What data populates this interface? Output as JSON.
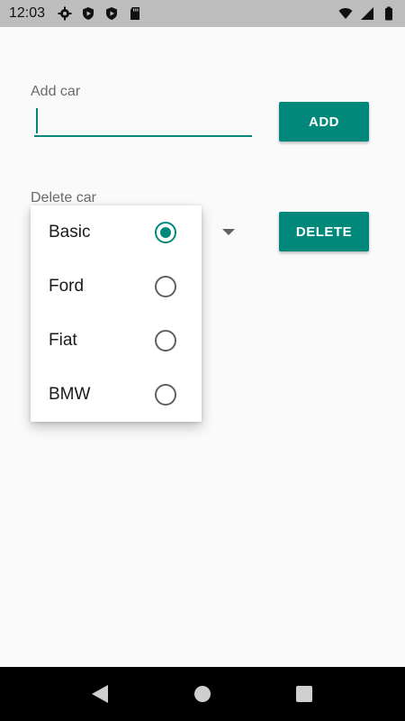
{
  "status_bar": {
    "time": "12:03",
    "left_icons": [
      "gear-icon",
      "play-shield-icon",
      "play-shield-icon",
      "sd-card-icon"
    ],
    "right_icons": [
      "wifi-icon",
      "signal-icon",
      "battery-icon"
    ]
  },
  "add_section": {
    "label": "Add car",
    "input_value": "",
    "button_label": "ADD"
  },
  "delete_section": {
    "label": "Delete car",
    "button_label": "DELETE",
    "dropdown_options": [
      {
        "label": "Basic",
        "selected": true
      },
      {
        "label": "Ford",
        "selected": false
      },
      {
        "label": "Fiat",
        "selected": false
      },
      {
        "label": "BMW",
        "selected": false
      }
    ]
  },
  "nav_bar": {
    "buttons": [
      "back-icon",
      "home-icon",
      "recents-icon"
    ]
  },
  "colors": {
    "accent": "#00897b",
    "status_bar": "#bdbdbd",
    "background": "#fafafa"
  }
}
